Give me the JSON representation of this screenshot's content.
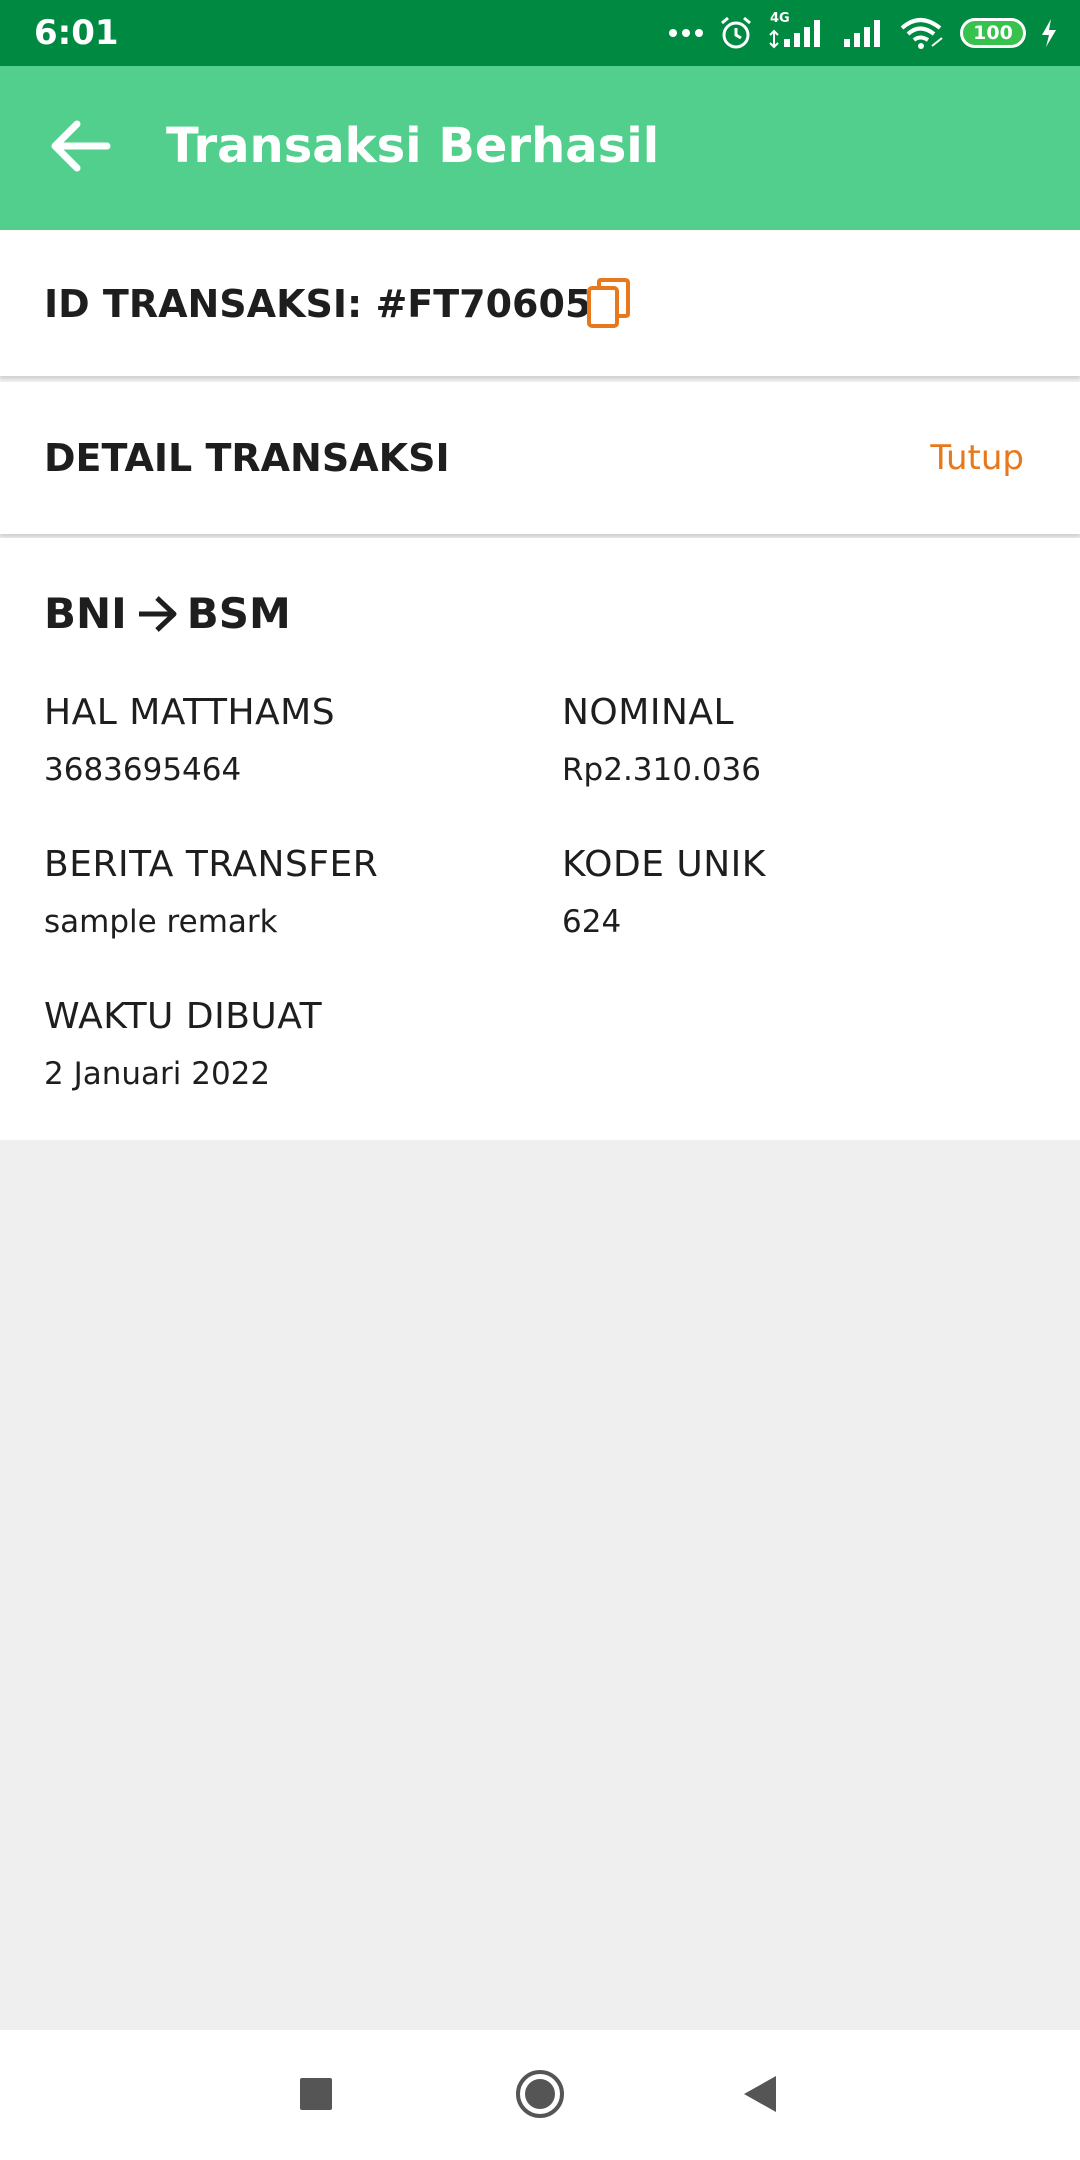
{
  "status_bar": {
    "time": "6:01",
    "network_label": "4G",
    "battery_level": "100",
    "icons": [
      "more-dots-icon",
      "alarm-icon",
      "signal-icon",
      "signal-icon",
      "wifi-icon",
      "battery-icon",
      "charging-icon"
    ]
  },
  "app_bar": {
    "title": "Transaksi Berhasil",
    "back_icon": "arrow-left-icon"
  },
  "transaction": {
    "id_label": "ID TRANSAKSI: #FT70605",
    "copy_icon": "copy-icon"
  },
  "detail": {
    "title": "DETAIL TRANSAKSI",
    "close_label": "Tutup",
    "route": {
      "from": "BNI",
      "to": "BSM"
    },
    "fields": {
      "account_name": "HAL MATTHAMS",
      "account_number": "3683695464",
      "nominal_label": "NOMINAL",
      "nominal_value": "Rp2.310.036",
      "remark_label": "BERITA TRANSFER",
      "remark_value": "sample remark",
      "unique_code_label": "KODE UNIK",
      "unique_code_value": "624",
      "created_label": "WAKTU DIBUAT",
      "created_value": "2 Januari 2022"
    }
  },
  "colors": {
    "status_bar": "#008a41",
    "app_bar": "#52cf8c",
    "accent": "#e8781c",
    "background": "#efefef"
  },
  "nav_bar": {
    "buttons": [
      "recents-square-icon",
      "home-circle-icon",
      "back-triangle-icon"
    ]
  }
}
